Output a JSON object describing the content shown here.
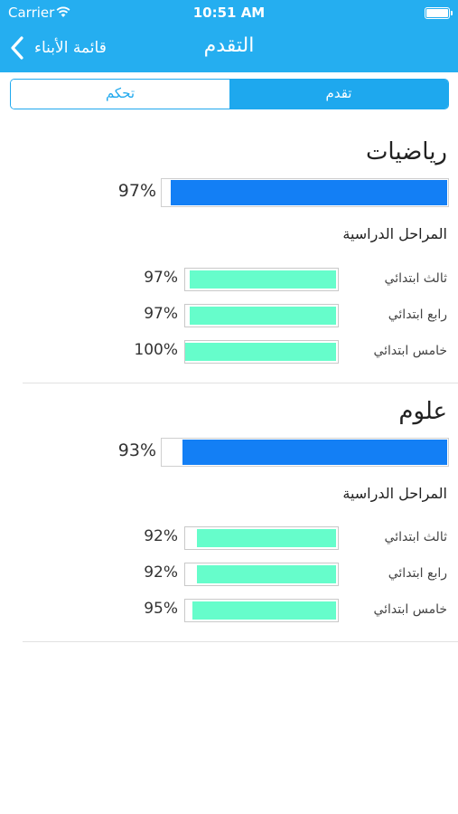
{
  "status_bar": {
    "carrier": "Carrier",
    "time": "10:51 AM"
  },
  "nav": {
    "back_label": "قائمة الأبناء",
    "title": "التقدم"
  },
  "segments": {
    "control": "تحكم",
    "progress": "تقدم",
    "selected": "progress"
  },
  "colors": {
    "header": "#25aef0",
    "overall_bar": "#137ff5",
    "stage_bar": "#66fdcb"
  },
  "subjects": [
    {
      "name": "رياضيات",
      "overall_pct": "97%",
      "overall_value": 97,
      "stages_label": "المراحل الدراسية",
      "stages": [
        {
          "name": "ثالث ابتدائي",
          "pct": "97%",
          "value": 97
        },
        {
          "name": "رابع ابتدائي",
          "pct": "97%",
          "value": 97
        },
        {
          "name": "خامس ابتدائي",
          "pct": "100%",
          "value": 100
        }
      ]
    },
    {
      "name": "علوم",
      "overall_pct": "93%",
      "overall_value": 93,
      "stages_label": "المراحل الدراسية",
      "stages": [
        {
          "name": "ثالث ابتدائي",
          "pct": "92%",
          "value": 92
        },
        {
          "name": "رابع ابتدائي",
          "pct": "92%",
          "value": 92
        },
        {
          "name": "خامس ابتدائي",
          "pct": "95%",
          "value": 95
        }
      ]
    }
  ]
}
